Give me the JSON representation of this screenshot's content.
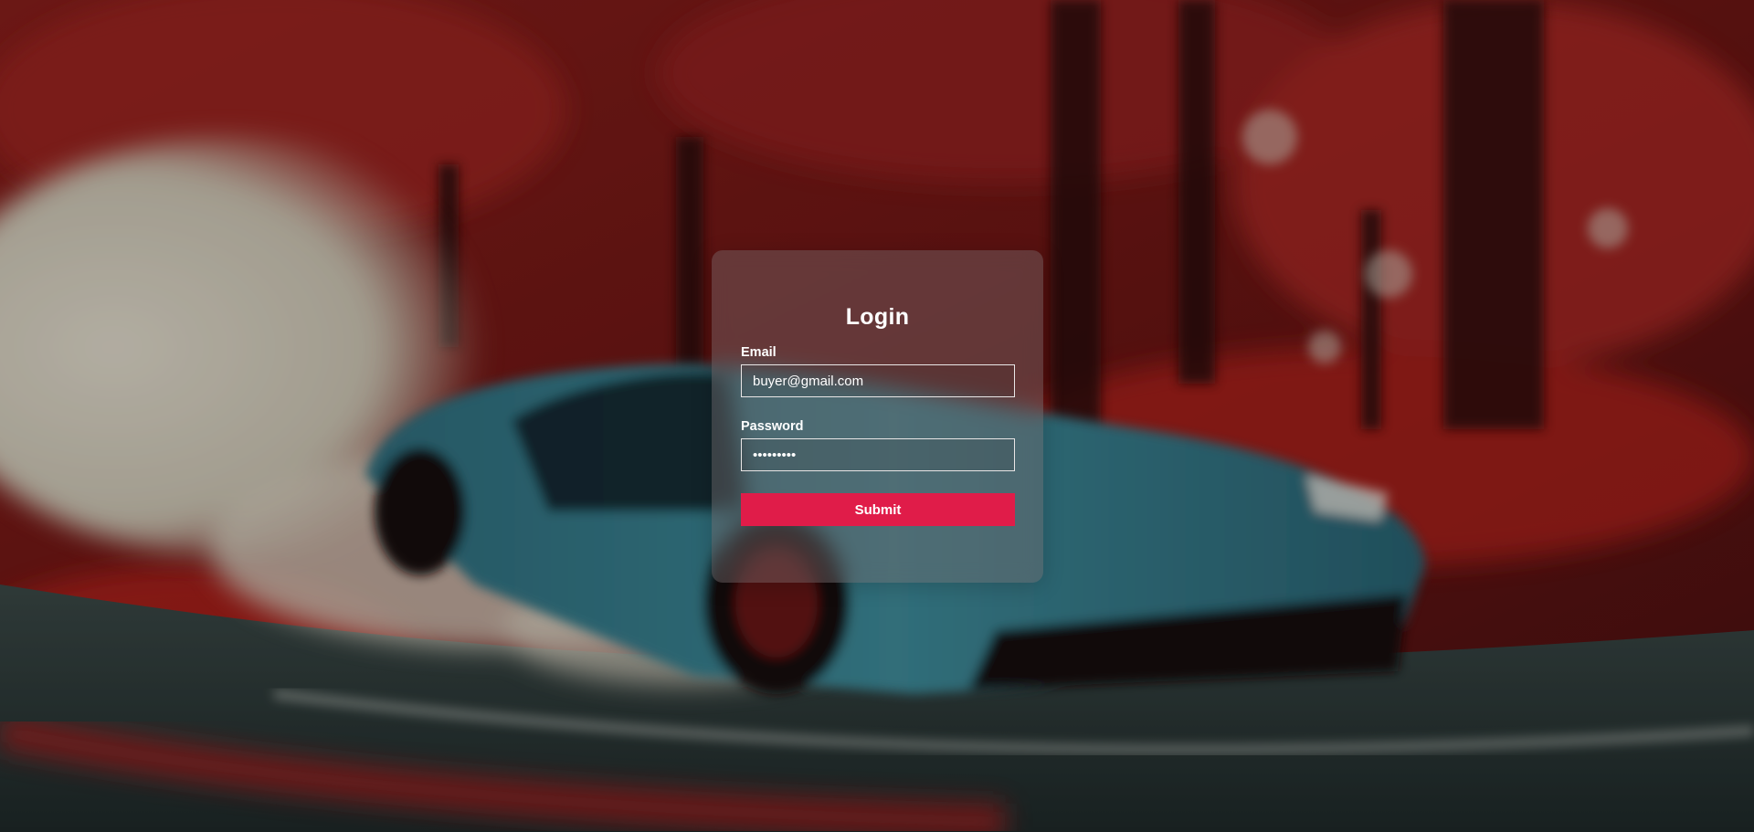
{
  "colors": {
    "accent": "#e01c49",
    "background_primary": "#7a1a1a",
    "card_background": "rgba(120,110,112,0.42)",
    "text": "#ffffff"
  },
  "login": {
    "title": "Login",
    "email_label": "Email",
    "email_value": "buyer@gmail.com",
    "password_label": "Password",
    "password_value": "ss3d4e5z7",
    "submit_label": "Submit"
  }
}
